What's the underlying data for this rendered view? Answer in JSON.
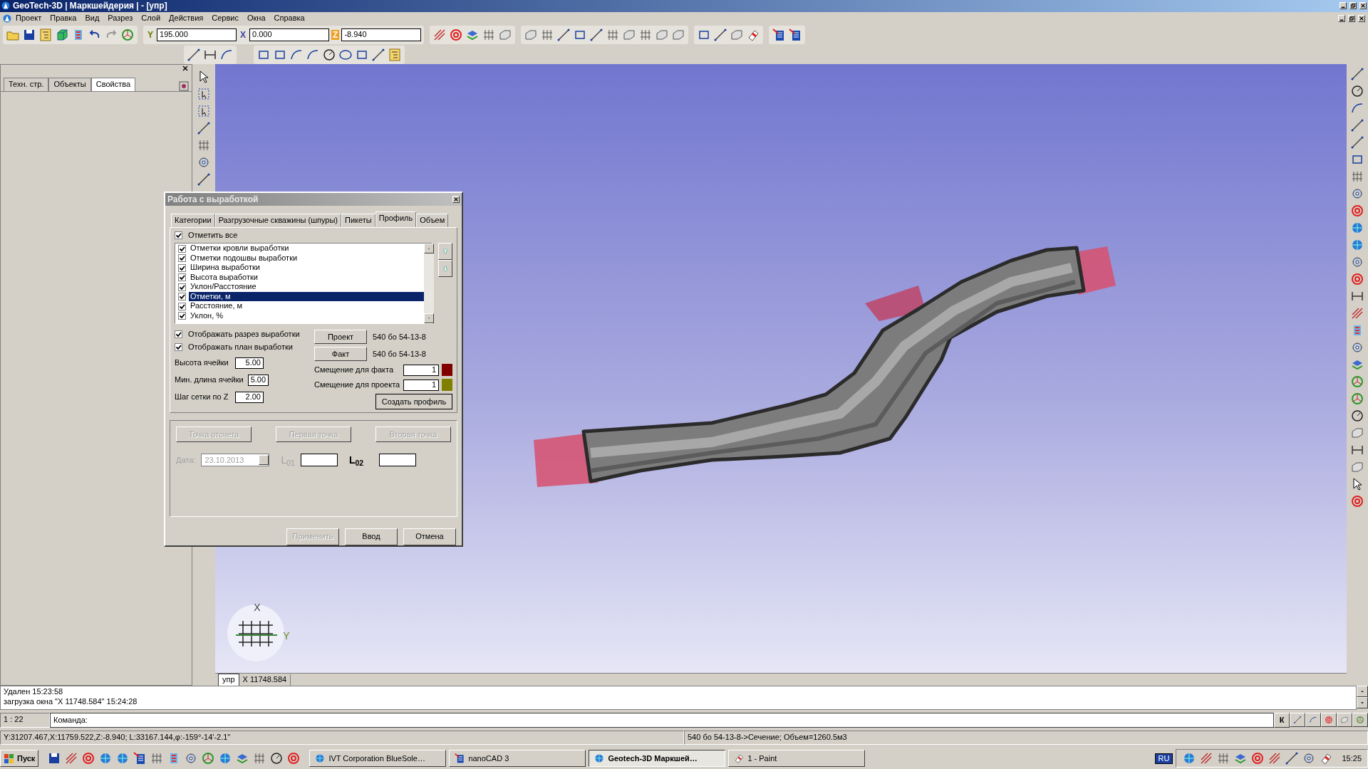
{
  "window": {
    "title": "GeoTech-3D | Маркшейдерия | - [упр]"
  },
  "menu": [
    "Проект",
    "Правка",
    "Вид",
    "Разрез",
    "Слой",
    "Действия",
    "Сервис",
    "Окна",
    "Справка"
  ],
  "coords": [
    {
      "axis": "Y",
      "value": "195.000"
    },
    {
      "axis": "X",
      "value": "0.000"
    },
    {
      "axis": "Z",
      "value": "-8.940"
    }
  ],
  "left_panel": {
    "tabs": [
      {
        "label": "Техн. стр.",
        "selected": false
      },
      {
        "label": "Объекты",
        "selected": false
      },
      {
        "label": "Свойства",
        "selected": true
      }
    ]
  },
  "dialog": {
    "title": "Работа с выработкой",
    "tabs": [
      {
        "label": "Категории",
        "selected": false
      },
      {
        "label": "Разгрузочные скважины (шпуры)",
        "selected": false
      },
      {
        "label": "Пикеты",
        "selected": false
      },
      {
        "label": "Профиль",
        "selected": true
      },
      {
        "label": "Объем",
        "selected": false
      }
    ],
    "check_all": {
      "label": "Отметить все",
      "checked": true
    },
    "items": [
      {
        "label": "Отметки кровли выработки",
        "checked": true,
        "selected": false
      },
      {
        "label": "Отметки подошвы выработки",
        "checked": true,
        "selected": false
      },
      {
        "label": "Ширина выработки",
        "checked": true,
        "selected": false
      },
      {
        "label": "Высота выработки",
        "checked": true,
        "selected": false
      },
      {
        "label": "Уклон/Расстояние",
        "checked": true,
        "selected": false
      },
      {
        "label": "Отметки, м",
        "checked": true,
        "selected": true
      },
      {
        "label": "Расстояние, м",
        "checked": true,
        "selected": false
      },
      {
        "label": "Уклон, %",
        "checked": true,
        "selected": false
      }
    ],
    "options": [
      {
        "label": "Отображать разрез выработки",
        "checked": true
      },
      {
        "label": "Отображать план выработки",
        "checked": true
      }
    ],
    "fields": [
      {
        "label": "Высота ячейки",
        "value": "5.00"
      },
      {
        "label": "Мин. длина ячейки",
        "value": "5.00"
      },
      {
        "label": "Шаг сетки по Z",
        "value": "2.00"
      }
    ],
    "sources": [
      {
        "button": "Проект",
        "value": "540 бо 54-13-8"
      },
      {
        "button": "Факт",
        "value": "540 бо 54-13-8"
      }
    ],
    "offsets": [
      {
        "label": "Смещение для факта",
        "value": "1",
        "color": "#800000"
      },
      {
        "label": "Смещение для проекта",
        "value": "1",
        "color": "#808000"
      }
    ],
    "create_button": "Создать профиль",
    "point_buttons": [
      {
        "label": "Точка отсчета",
        "disabled": true
      },
      {
        "label": "Первая точка",
        "disabled": true
      },
      {
        "label": "Вторая точка",
        "disabled": true
      }
    ],
    "date": {
      "label": "Дата:",
      "value": "23.10.2013",
      "disabled": true
    },
    "lengths": [
      {
        "label": "L$_{01}$",
        "disabled": true
      },
      {
        "label": "L$_{02}$",
        "disabled": false
      }
    ],
    "footer_buttons": [
      {
        "label": "Применить",
        "disabled": true
      },
      {
        "label": "Ввод",
        "disabled": false
      },
      {
        "label": "Отмена",
        "disabled": false
      }
    ]
  },
  "viewport": {
    "axis_labels": [
      "X",
      "Y"
    ],
    "tabs": [
      {
        "label": "упр",
        "selected": true
      },
      {
        "label": "X 11748.584",
        "selected": false
      }
    ]
  },
  "log": [
    "Удален 15:23:58",
    "загрузка окна \"X 11748.584\" 15:24:28"
  ],
  "command": {
    "scale": "1 : 22",
    "label": "Команда:",
    "snap_key": "К"
  },
  "status_bar": {
    "coordinates": "Y:31207.467,X:11759.522,Z:-8.940; L:33167.144,φ:-159°-14'-2.1\"",
    "info": "540 бо 54-13-8->Сечение; Объем=1260.5м3"
  },
  "taskbar": {
    "start": "Пуск",
    "tasks": [
      {
        "label": "IVT Corporation BlueSole…",
        "selected": false
      },
      {
        "label": "nanoCAD 3",
        "selected": false
      },
      {
        "label": "Geotech-3D Маркшей…",
        "selected": true
      },
      {
        "label": "1 - Paint",
        "selected": false
      }
    ],
    "language": "RU",
    "clock": "15:25"
  }
}
